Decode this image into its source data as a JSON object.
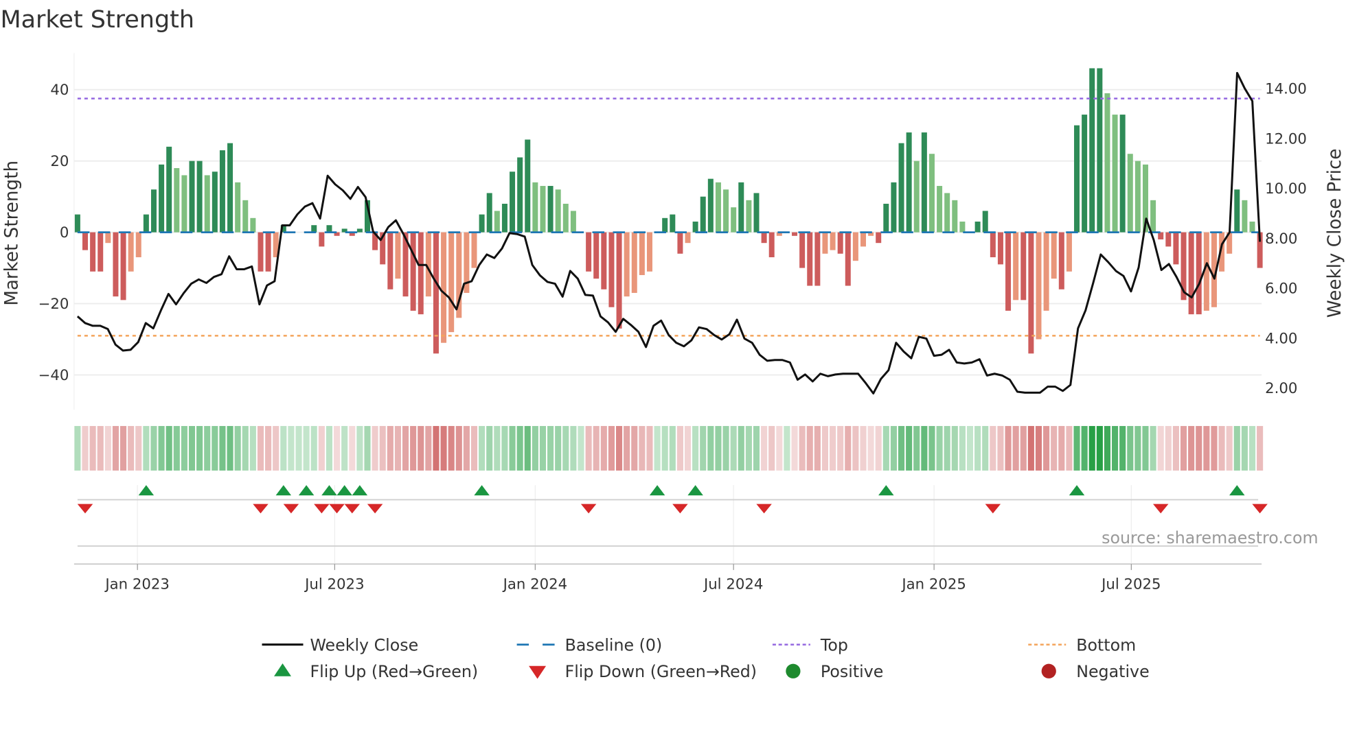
{
  "chart_data": {
    "type": "bar",
    "title": "Market Strength",
    "ylabel": "Market Strength",
    "y2label": "Weekly Close Price",
    "ylim": [
      -50,
      50
    ],
    "y2lim": [
      1.0,
      15.2
    ],
    "yticks": [
      {
        "v": 40,
        "label": "40"
      },
      {
        "v": 20,
        "label": "20"
      },
      {
        "v": 0,
        "label": "0"
      },
      {
        "v": -20,
        "label": "−20"
      },
      {
        "v": -40,
        "label": "−40"
      }
    ],
    "y2ticks": [
      {
        "v": 14,
        "label": "14.00"
      },
      {
        "v": 12,
        "label": "12.00"
      },
      {
        "v": 10,
        "label": "10.00"
      },
      {
        "v": 8,
        "label": "8.00"
      },
      {
        "v": 6,
        "label": "6.00"
      },
      {
        "v": 4,
        "label": "4.00"
      },
      {
        "v": 2,
        "label": "2.00"
      }
    ],
    "xticks": [
      {
        "date": "2023-01-01",
        "label": "Jan 2023"
      },
      {
        "date": "2023-07-01",
        "label": "Jul 2023"
      },
      {
        "date": "2024-01-01",
        "label": "Jan 2024"
      },
      {
        "date": "2024-07-01",
        "label": "Jul 2024"
      },
      {
        "date": "2025-01-01",
        "label": "Jan 2025"
      },
      {
        "date": "2025-07-01",
        "label": "Jul 2025"
      }
    ],
    "start_date": "2022-11-07",
    "interval": "weekly",
    "top_level": 37.5,
    "bottom_level": -29,
    "baseline": 0,
    "strength": [
      5,
      -5,
      -11,
      -11,
      -3,
      -18,
      -19,
      -11,
      -7,
      5,
      12,
      19,
      24,
      18,
      16,
      20,
      20,
      16,
      17,
      23,
      25,
      14,
      9,
      4,
      -11,
      -11,
      -7,
      2,
      0,
      0,
      0,
      2,
      -4,
      2,
      -1,
      1,
      -1,
      1,
      9,
      -5,
      -9,
      -16,
      -13,
      -18,
      -22,
      -23,
      -18,
      -34,
      -31,
      -28,
      -24,
      -17,
      -10,
      5,
      11,
      6,
      8,
      17,
      21,
      26,
      14,
      13,
      13,
      12,
      8,
      6,
      0,
      -11,
      -13,
      -16,
      -21,
      -27,
      -18,
      -17,
      -12,
      -11,
      0,
      4,
      5,
      -6,
      -3,
      3,
      10,
      15,
      14,
      12,
      7,
      14,
      9,
      11,
      -3,
      -7,
      -1,
      0,
      -1,
      -10,
      -15,
      -15,
      -6,
      -5,
      -6,
      -15,
      -8,
      -4,
      -1,
      -3,
      8,
      14,
      25,
      28,
      20,
      28,
      22,
      13,
      11,
      9,
      3,
      0,
      3,
      6,
      -7,
      -9,
      -22,
      -19,
      -19,
      -34,
      -30,
      -22,
      -13,
      -16,
      -11,
      30,
      33,
      46,
      46,
      39,
      33,
      33,
      22,
      20,
      19,
      9,
      -2,
      -4,
      -9,
      -19,
      -23,
      -23,
      -22,
      -21,
      -11,
      -6,
      12,
      9,
      3,
      -10
    ],
    "weekly_close": [
      4.87,
      4.6,
      4.49,
      4.49,
      4.36,
      3.74,
      3.5,
      3.53,
      3.84,
      4.6,
      4.39,
      5.11,
      5.77,
      5.35,
      5.8,
      6.18,
      6.35,
      6.21,
      6.45,
      6.56,
      7.28,
      6.76,
      6.76,
      6.87,
      5.35,
      6.11,
      6.28,
      8.52,
      8.52,
      8.96,
      9.27,
      9.41,
      8.79,
      10.51,
      10.16,
      9.92,
      9.58,
      10.06,
      9.65,
      8.27,
      7.93,
      8.45,
      8.72,
      8.17,
      7.55,
      6.93,
      6.93,
      6.38,
      5.9,
      5.63,
      5.15,
      6.18,
      6.28,
      6.93,
      7.35,
      7.21,
      7.59,
      8.21,
      8.17,
      8.07,
      6.93,
      6.52,
      6.25,
      6.18,
      5.66,
      6.69,
      6.38,
      5.73,
      5.7,
      4.87,
      4.63,
      4.25,
      4.77,
      4.53,
      4.25,
      3.64,
      4.49,
      4.7,
      4.12,
      3.81,
      3.67,
      3.91,
      4.43,
      4.36,
      4.12,
      3.94,
      4.15,
      4.74,
      3.98,
      3.81,
      3.33,
      3.09,
      3.12,
      3.12,
      3.02,
      2.33,
      2.54,
      2.26,
      2.57,
      2.47,
      2.54,
      2.57,
      2.57,
      2.57,
      2.19,
      1.78,
      2.36,
      2.71,
      3.81,
      3.46,
      3.19,
      4.05,
      3.98,
      3.29,
      3.33,
      3.53,
      3.02,
      2.98,
      3.02,
      3.15,
      2.5,
      2.57,
      2.5,
      2.33,
      1.85,
      1.81,
      1.81,
      1.81,
      2.05,
      2.05,
      1.88,
      2.12,
      4.39,
      5.11,
      6.21,
      7.35,
      7.04,
      6.69,
      6.49,
      5.87,
      6.83,
      8.79,
      7.93,
      6.73,
      6.97,
      6.45,
      5.84,
      5.63,
      6.18,
      7.0,
      6.38,
      7.76,
      8.24,
      14.63,
      14.01,
      13.5,
      7.86
    ],
    "flip_up_weeks": [
      9,
      27,
      30,
      33,
      35,
      37,
      53,
      76,
      81,
      106,
      131,
      152
    ],
    "flip_down_weeks": [
      1,
      24,
      28,
      32,
      34,
      36,
      39,
      67,
      79,
      90,
      120,
      142,
      155
    ],
    "colors": {
      "pos_strong": "#2e8b57",
      "pos_weak": "#7fbf7f",
      "neg_strong": "#cd5c5c",
      "neg_weak": "#e9967a",
      "line": "#111111",
      "baseline": "#1f77b4",
      "top": "#9467e0",
      "bottom": "#f4a45a",
      "flip_up": "#1a9641",
      "flip_down": "#d62728",
      "positive": "#1e8a2e",
      "negative": "#b22222"
    },
    "legend": [
      {
        "key": "line",
        "label": "Weekly Close"
      },
      {
        "key": "baseline",
        "label": "Baseline (0)"
      },
      {
        "key": "top",
        "label": "Top"
      },
      {
        "key": "bottom",
        "label": "Bottom"
      },
      {
        "key": "flip_up",
        "label": "Flip Up (Red→Green)"
      },
      {
        "key": "flip_down",
        "label": "Flip Down (Green→Red)"
      },
      {
        "key": "positive",
        "label": "Positive"
      },
      {
        "key": "negative",
        "label": "Negative"
      }
    ],
    "legend_position": "bottom",
    "source": "source: sharemaestro.com"
  }
}
